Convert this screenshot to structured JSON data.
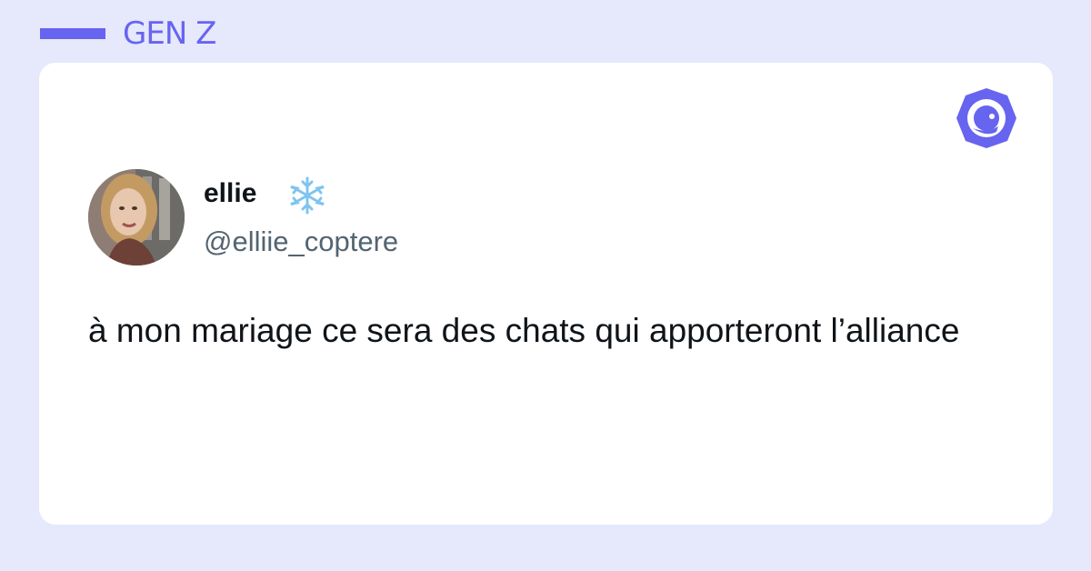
{
  "header": {
    "category": "GEN Z",
    "accent_color": "#6764f0"
  },
  "brand": {
    "icon": "bird-chick-logo-icon"
  },
  "tweet": {
    "author_name": "ellie",
    "author_emoji": "snowflake-icon",
    "author_handle": "@elliie_coptere",
    "text": "à mon mariage ce sera des chats qui apporteront l’alliance"
  },
  "colors": {
    "background": "#e6e8fb",
    "card": "#ffffff",
    "text": "#0f1419",
    "handle": "#536471",
    "snowflake": "#7fc4f0"
  }
}
